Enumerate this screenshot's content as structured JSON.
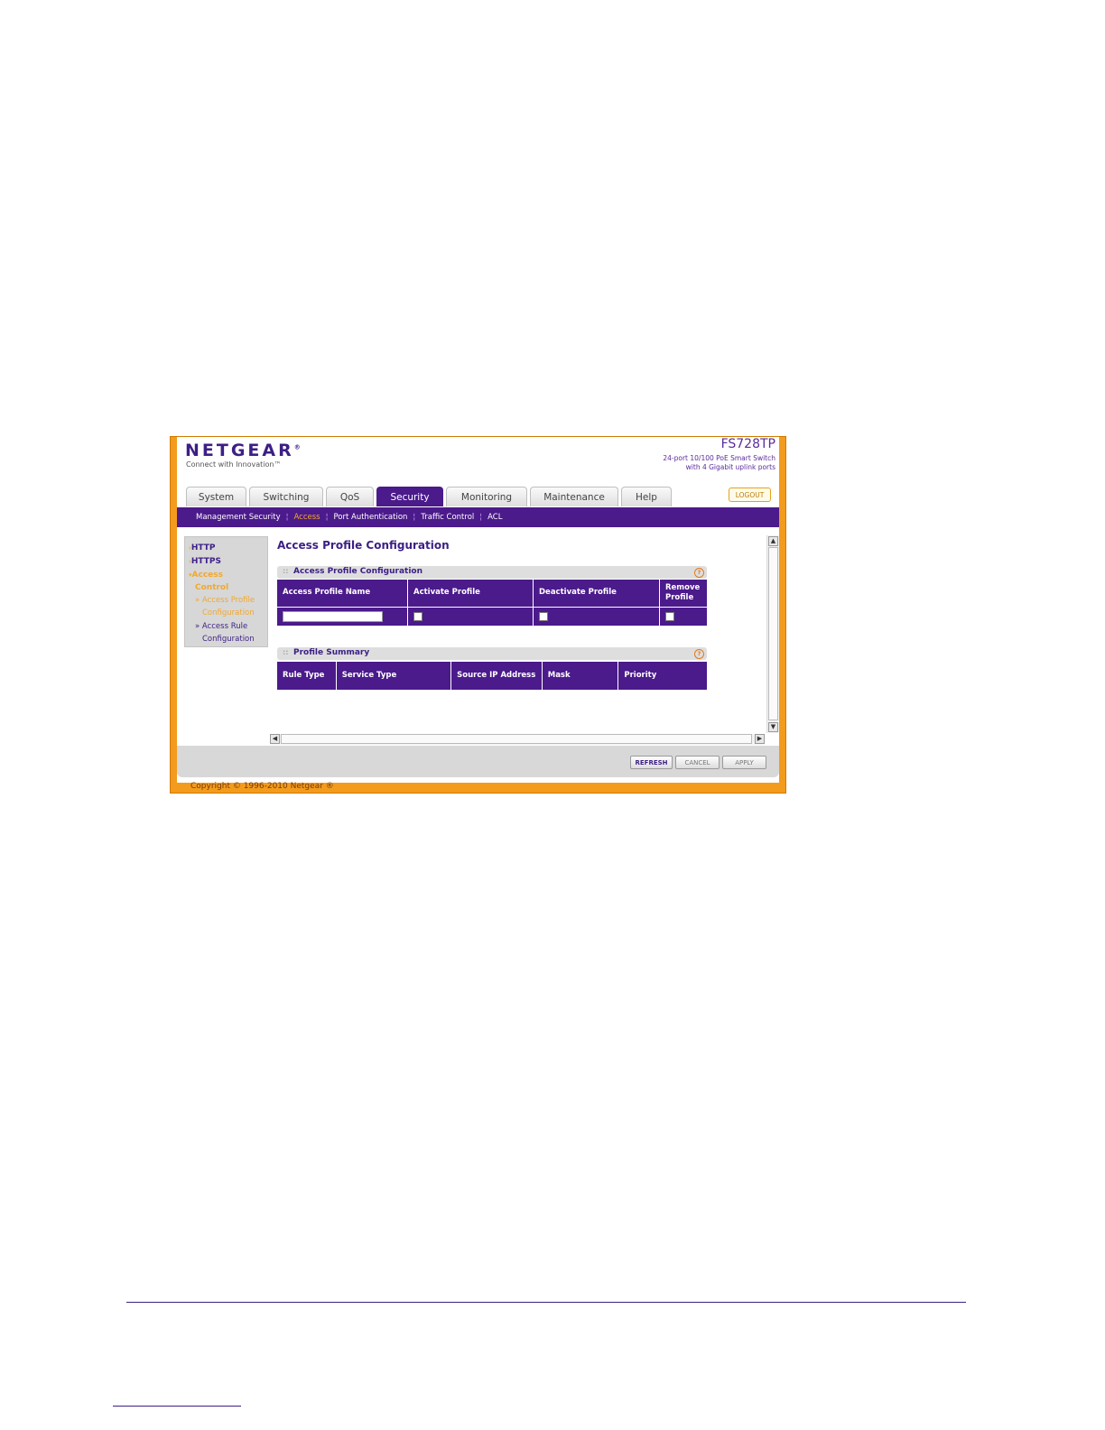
{
  "brand": {
    "logo": "NETGEAR",
    "registered": "®",
    "tagline": "Connect with Innovation™"
  },
  "device": {
    "model": "FS728TP",
    "description_line1": "24-port 10/100 PoE Smart Switch",
    "description_line2": "with 4 Gigabit uplink ports"
  },
  "tabs": [
    {
      "label": "System"
    },
    {
      "label": "Switching"
    },
    {
      "label": "QoS"
    },
    {
      "label": "Security"
    },
    {
      "label": "Monitoring"
    },
    {
      "label": "Maintenance"
    },
    {
      "label": "Help"
    }
  ],
  "active_tab": "Security",
  "logout_label": "LOGOUT",
  "subnav": [
    {
      "label": "Management Security"
    },
    {
      "label": "Access"
    },
    {
      "label": "Port Authentication"
    },
    {
      "label": "Traffic Control"
    },
    {
      "label": "ACL"
    }
  ],
  "active_subnav": "Access",
  "sidebar": {
    "http": "HTTP",
    "https": "HTTPS",
    "access_control_1": "Access",
    "access_control_2": "Control",
    "profile_1": "» Access Profile",
    "profile_2": "Configuration",
    "rule_1": "» Access Rule",
    "rule_2": "Configuration"
  },
  "page_title": "Access Profile Configuration",
  "config_panel": {
    "title": "Access Profile Configuration",
    "columns": [
      "Access Profile Name",
      "Activate Profile",
      "Deactivate Profile",
      "Remove Profile"
    ]
  },
  "summary_panel": {
    "title": "Profile Summary",
    "columns": [
      "Rule Type",
      "Service Type",
      "Source IP Address",
      "Mask",
      "Priority"
    ]
  },
  "buttons": {
    "refresh": "REFRESH",
    "cancel": "CANCEL",
    "apply": "APPLY"
  },
  "copyright": "Copyright © 1996-2010 Netgear ®",
  "colors": {
    "brand_purple": "#4b1a8b",
    "accent_orange": "#f29b1d"
  }
}
